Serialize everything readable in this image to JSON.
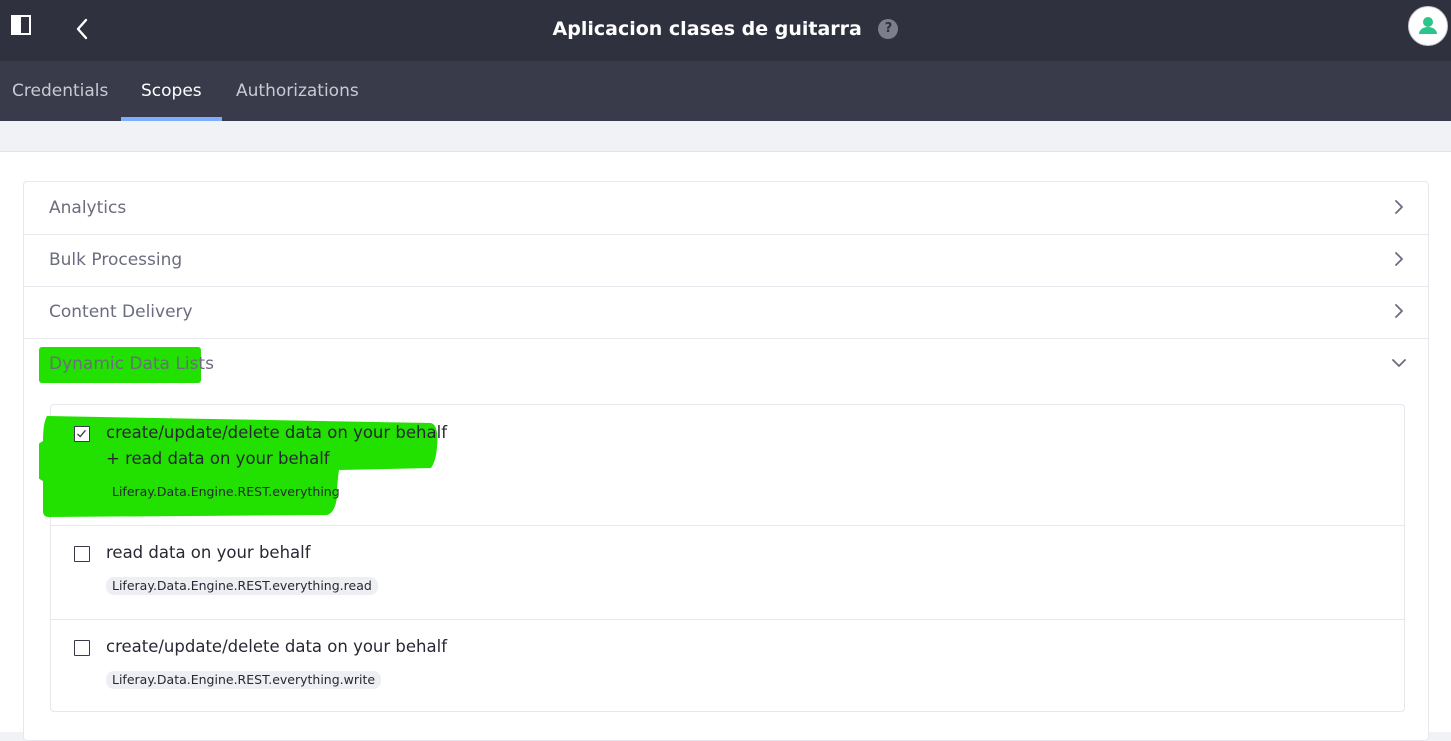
{
  "header": {
    "title": "Aplicacion clases de guitarra",
    "help_glyph": "?"
  },
  "tabs": [
    {
      "label": "Credentials",
      "active": false
    },
    {
      "label": "Scopes",
      "active": true
    },
    {
      "label": "Authorizations",
      "active": false
    }
  ],
  "sections": [
    {
      "label": "Analytics",
      "expanded": false
    },
    {
      "label": "Bulk Processing",
      "expanded": false
    },
    {
      "label": "Content Delivery",
      "expanded": false
    },
    {
      "label": "Dynamic Data Lists",
      "expanded": true,
      "highlighted": true
    }
  ],
  "scopes": [
    {
      "title_line1": "create/update/delete data on your behalf",
      "title_line2": "+ read data on your behalf",
      "badge": "Liferay.Data.Engine.REST.everything",
      "checked": true,
      "highlighted": true
    },
    {
      "title_line1": "read data on your behalf",
      "badge": "Liferay.Data.Engine.REST.everything.read",
      "checked": false
    },
    {
      "title_line1": "create/update/delete data on your behalf",
      "badge": "Liferay.Data.Engine.REST.everything.write",
      "checked": false
    }
  ],
  "colors": {
    "header_bg": "#30313f",
    "tab_bg": "#393a4a",
    "tab_active_indicator": "#80acff",
    "highlight": "#22e000"
  },
  "icons": [
    "sidebar-toggle-icon",
    "back-icon",
    "help-icon",
    "user-avatar-icon",
    "chevron-right-icon",
    "chevron-down-icon",
    "checkbox-icon"
  ]
}
